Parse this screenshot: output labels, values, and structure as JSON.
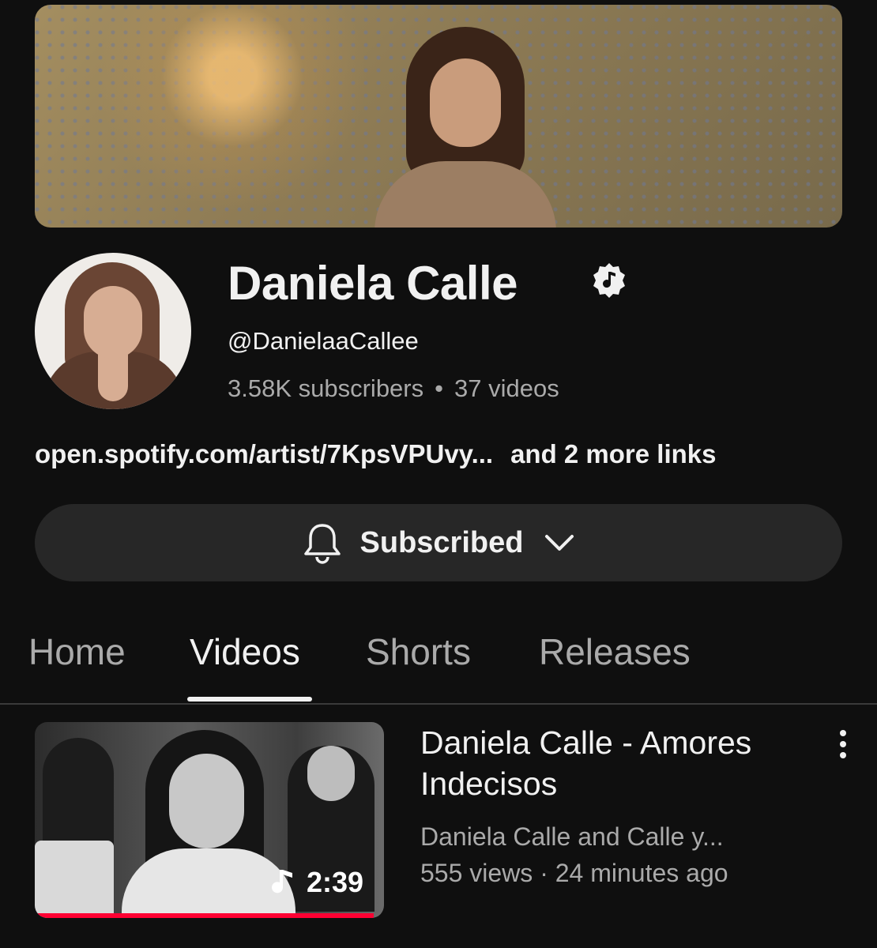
{
  "channel": {
    "name": "Daniela Calle",
    "handle": "@DanielaaCallee",
    "subscribers": "3.58K subscribers",
    "separator": "•",
    "videos": "37 videos",
    "verified_icon": "music-note-verified-badge"
  },
  "links": {
    "primary": "open.spotify.com/artist/7KpsVPUvy...",
    "more": "and 2 more links"
  },
  "subscribe_button": {
    "label": "Subscribed",
    "icon": "bell-icon",
    "chevron": "chevron-down-icon"
  },
  "tabs": [
    {
      "label": "Home",
      "active": false
    },
    {
      "label": "Videos",
      "active": true
    },
    {
      "label": "Shorts",
      "active": false
    },
    {
      "label": "Releases",
      "active": false
    }
  ],
  "videos": [
    {
      "title": "Daniela Calle - Amores Indecisos",
      "channel": "Daniela Calle and Calle y...",
      "stats": "555 views · 24 minutes ago",
      "duration": "2:39",
      "watched_fraction": 0.97,
      "progress_color": "#ff0033"
    }
  ],
  "colors": {
    "background": "#0f0f0f",
    "button_bg": "#272727",
    "text_primary": "#f1f1f1",
    "text_secondary": "#aaaaaa"
  }
}
